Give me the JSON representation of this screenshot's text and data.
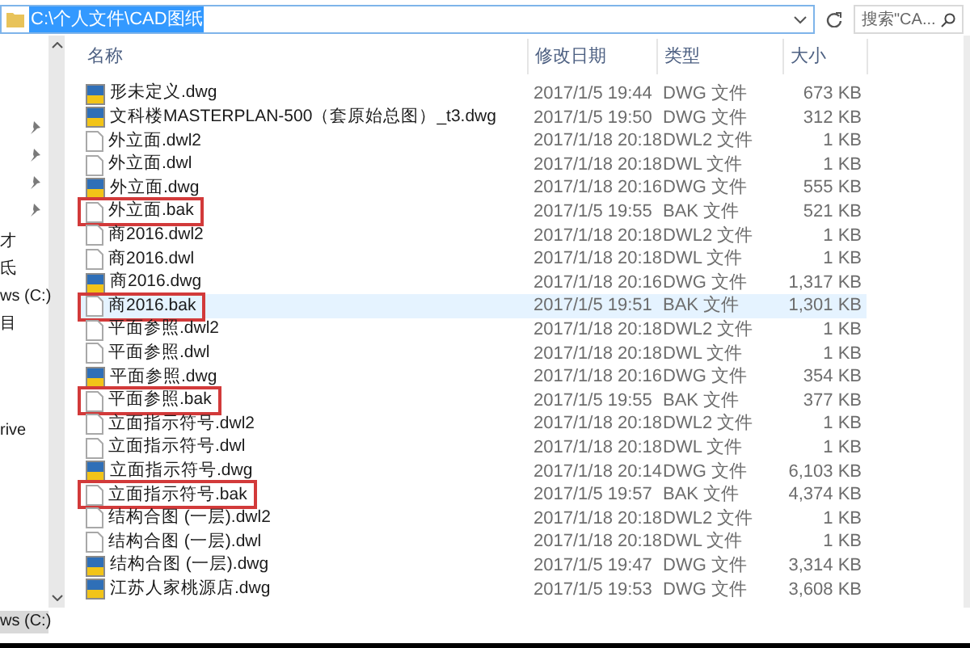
{
  "address_bar": {
    "path": "C:\\个人文件\\CAD图纸",
    "selected": true
  },
  "search": {
    "placeholder": "搜索\"CA..."
  },
  "nav_pane": {
    "items": [
      {
        "label": "才",
        "selected": false
      },
      {
        "label": "氐",
        "selected": false
      },
      {
        "label": "ws (C:)",
        "selected": false
      },
      {
        "label": "目",
        "selected": false
      },
      {
        "label": "rive",
        "selected": false
      },
      {
        "label": "ws (C:)",
        "selected": true
      }
    ]
  },
  "table": {
    "columns": [
      "名称",
      "修改日期",
      "类型",
      "大小"
    ],
    "rows": [
      {
        "kind": "dwg",
        "name": "形未定义.dwg",
        "date": "2017/1/5 19:44",
        "type": "DWG 文件",
        "size": "673 KB",
        "marked": false,
        "selected": false
      },
      {
        "kind": "dwg",
        "name": "文科楼MASTERPLAN-500（套原始总图）_t3.dwg",
        "date": "2017/1/5 19:50",
        "type": "DWG 文件",
        "size": "312 KB",
        "marked": false,
        "selected": false
      },
      {
        "kind": "file",
        "name": "外立面.dwl2",
        "date": "2017/1/18 20:18",
        "type": "DWL2 文件",
        "size": "1 KB",
        "marked": false,
        "selected": false
      },
      {
        "kind": "file",
        "name": "外立面.dwl",
        "date": "2017/1/18 20:18",
        "type": "DWL 文件",
        "size": "1 KB",
        "marked": false,
        "selected": false
      },
      {
        "kind": "dwg",
        "name": "外立面.dwg",
        "date": "2017/1/18 20:16",
        "type": "DWG 文件",
        "size": "555 KB",
        "marked": false,
        "selected": false
      },
      {
        "kind": "file",
        "name": "外立面.bak",
        "date": "2017/1/5 19:55",
        "type": "BAK 文件",
        "size": "521 KB",
        "marked": true,
        "selected": false
      },
      {
        "kind": "file",
        "name": "商2016.dwl2",
        "date": "2017/1/18 20:18",
        "type": "DWL2 文件",
        "size": "1 KB",
        "marked": false,
        "selected": false
      },
      {
        "kind": "file",
        "name": "商2016.dwl",
        "date": "2017/1/18 20:18",
        "type": "DWL 文件",
        "size": "1 KB",
        "marked": false,
        "selected": false
      },
      {
        "kind": "dwg",
        "name": "商2016.dwg",
        "date": "2017/1/18 20:16",
        "type": "DWG 文件",
        "size": "1,317 KB",
        "marked": false,
        "selected": false
      },
      {
        "kind": "file",
        "name": "商2016.bak",
        "date": "2017/1/5 19:51",
        "type": "BAK 文件",
        "size": "1,301 KB",
        "marked": true,
        "selected": true
      },
      {
        "kind": "file",
        "name": "平面参照.dwl2",
        "date": "2017/1/18 20:18",
        "type": "DWL2 文件",
        "size": "1 KB",
        "marked": false,
        "selected": false
      },
      {
        "kind": "file",
        "name": "平面参照.dwl",
        "date": "2017/1/18 20:18",
        "type": "DWL 文件",
        "size": "1 KB",
        "marked": false,
        "selected": false
      },
      {
        "kind": "dwg",
        "name": "平面参照.dwg",
        "date": "2017/1/18 20:16",
        "type": "DWG 文件",
        "size": "354 KB",
        "marked": false,
        "selected": false
      },
      {
        "kind": "file",
        "name": "平面参照.bak",
        "date": "2017/1/5 19:55",
        "type": "BAK 文件",
        "size": "377 KB",
        "marked": true,
        "selected": false
      },
      {
        "kind": "file",
        "name": "立面指示符号.dwl2",
        "date": "2017/1/18 20:18",
        "type": "DWL2 文件",
        "size": "1 KB",
        "marked": false,
        "selected": false
      },
      {
        "kind": "file",
        "name": "立面指示符号.dwl",
        "date": "2017/1/18 20:18",
        "type": "DWL 文件",
        "size": "1 KB",
        "marked": false,
        "selected": false
      },
      {
        "kind": "dwg",
        "name": "立面指示符号.dwg",
        "date": "2017/1/18 20:14",
        "type": "DWG 文件",
        "size": "6,103 KB",
        "marked": false,
        "selected": false
      },
      {
        "kind": "file",
        "name": "立面指示符号.bak",
        "date": "2017/1/5 19:57",
        "type": "BAK 文件",
        "size": "4,374 KB",
        "marked": true,
        "selected": false
      },
      {
        "kind": "file",
        "name": "结构合图 (一层).dwl2",
        "date": "2017/1/18 20:18",
        "type": "DWL2 文件",
        "size": "1 KB",
        "marked": false,
        "selected": false
      },
      {
        "kind": "file",
        "name": "结构合图 (一层).dwl",
        "date": "2017/1/18 20:18",
        "type": "DWL 文件",
        "size": "1 KB",
        "marked": false,
        "selected": false
      },
      {
        "kind": "dwg",
        "name": "结构合图 (一层).dwg",
        "date": "2017/1/5 19:47",
        "type": "DWG 文件",
        "size": "3,314 KB",
        "marked": false,
        "selected": false
      },
      {
        "kind": "dwg",
        "name": "江苏人家桃源店.dwg",
        "date": "2017/1/5 19:53",
        "type": "DWG 文件",
        "size": "3,608 KB",
        "marked": false,
        "selected": false
      }
    ]
  }
}
